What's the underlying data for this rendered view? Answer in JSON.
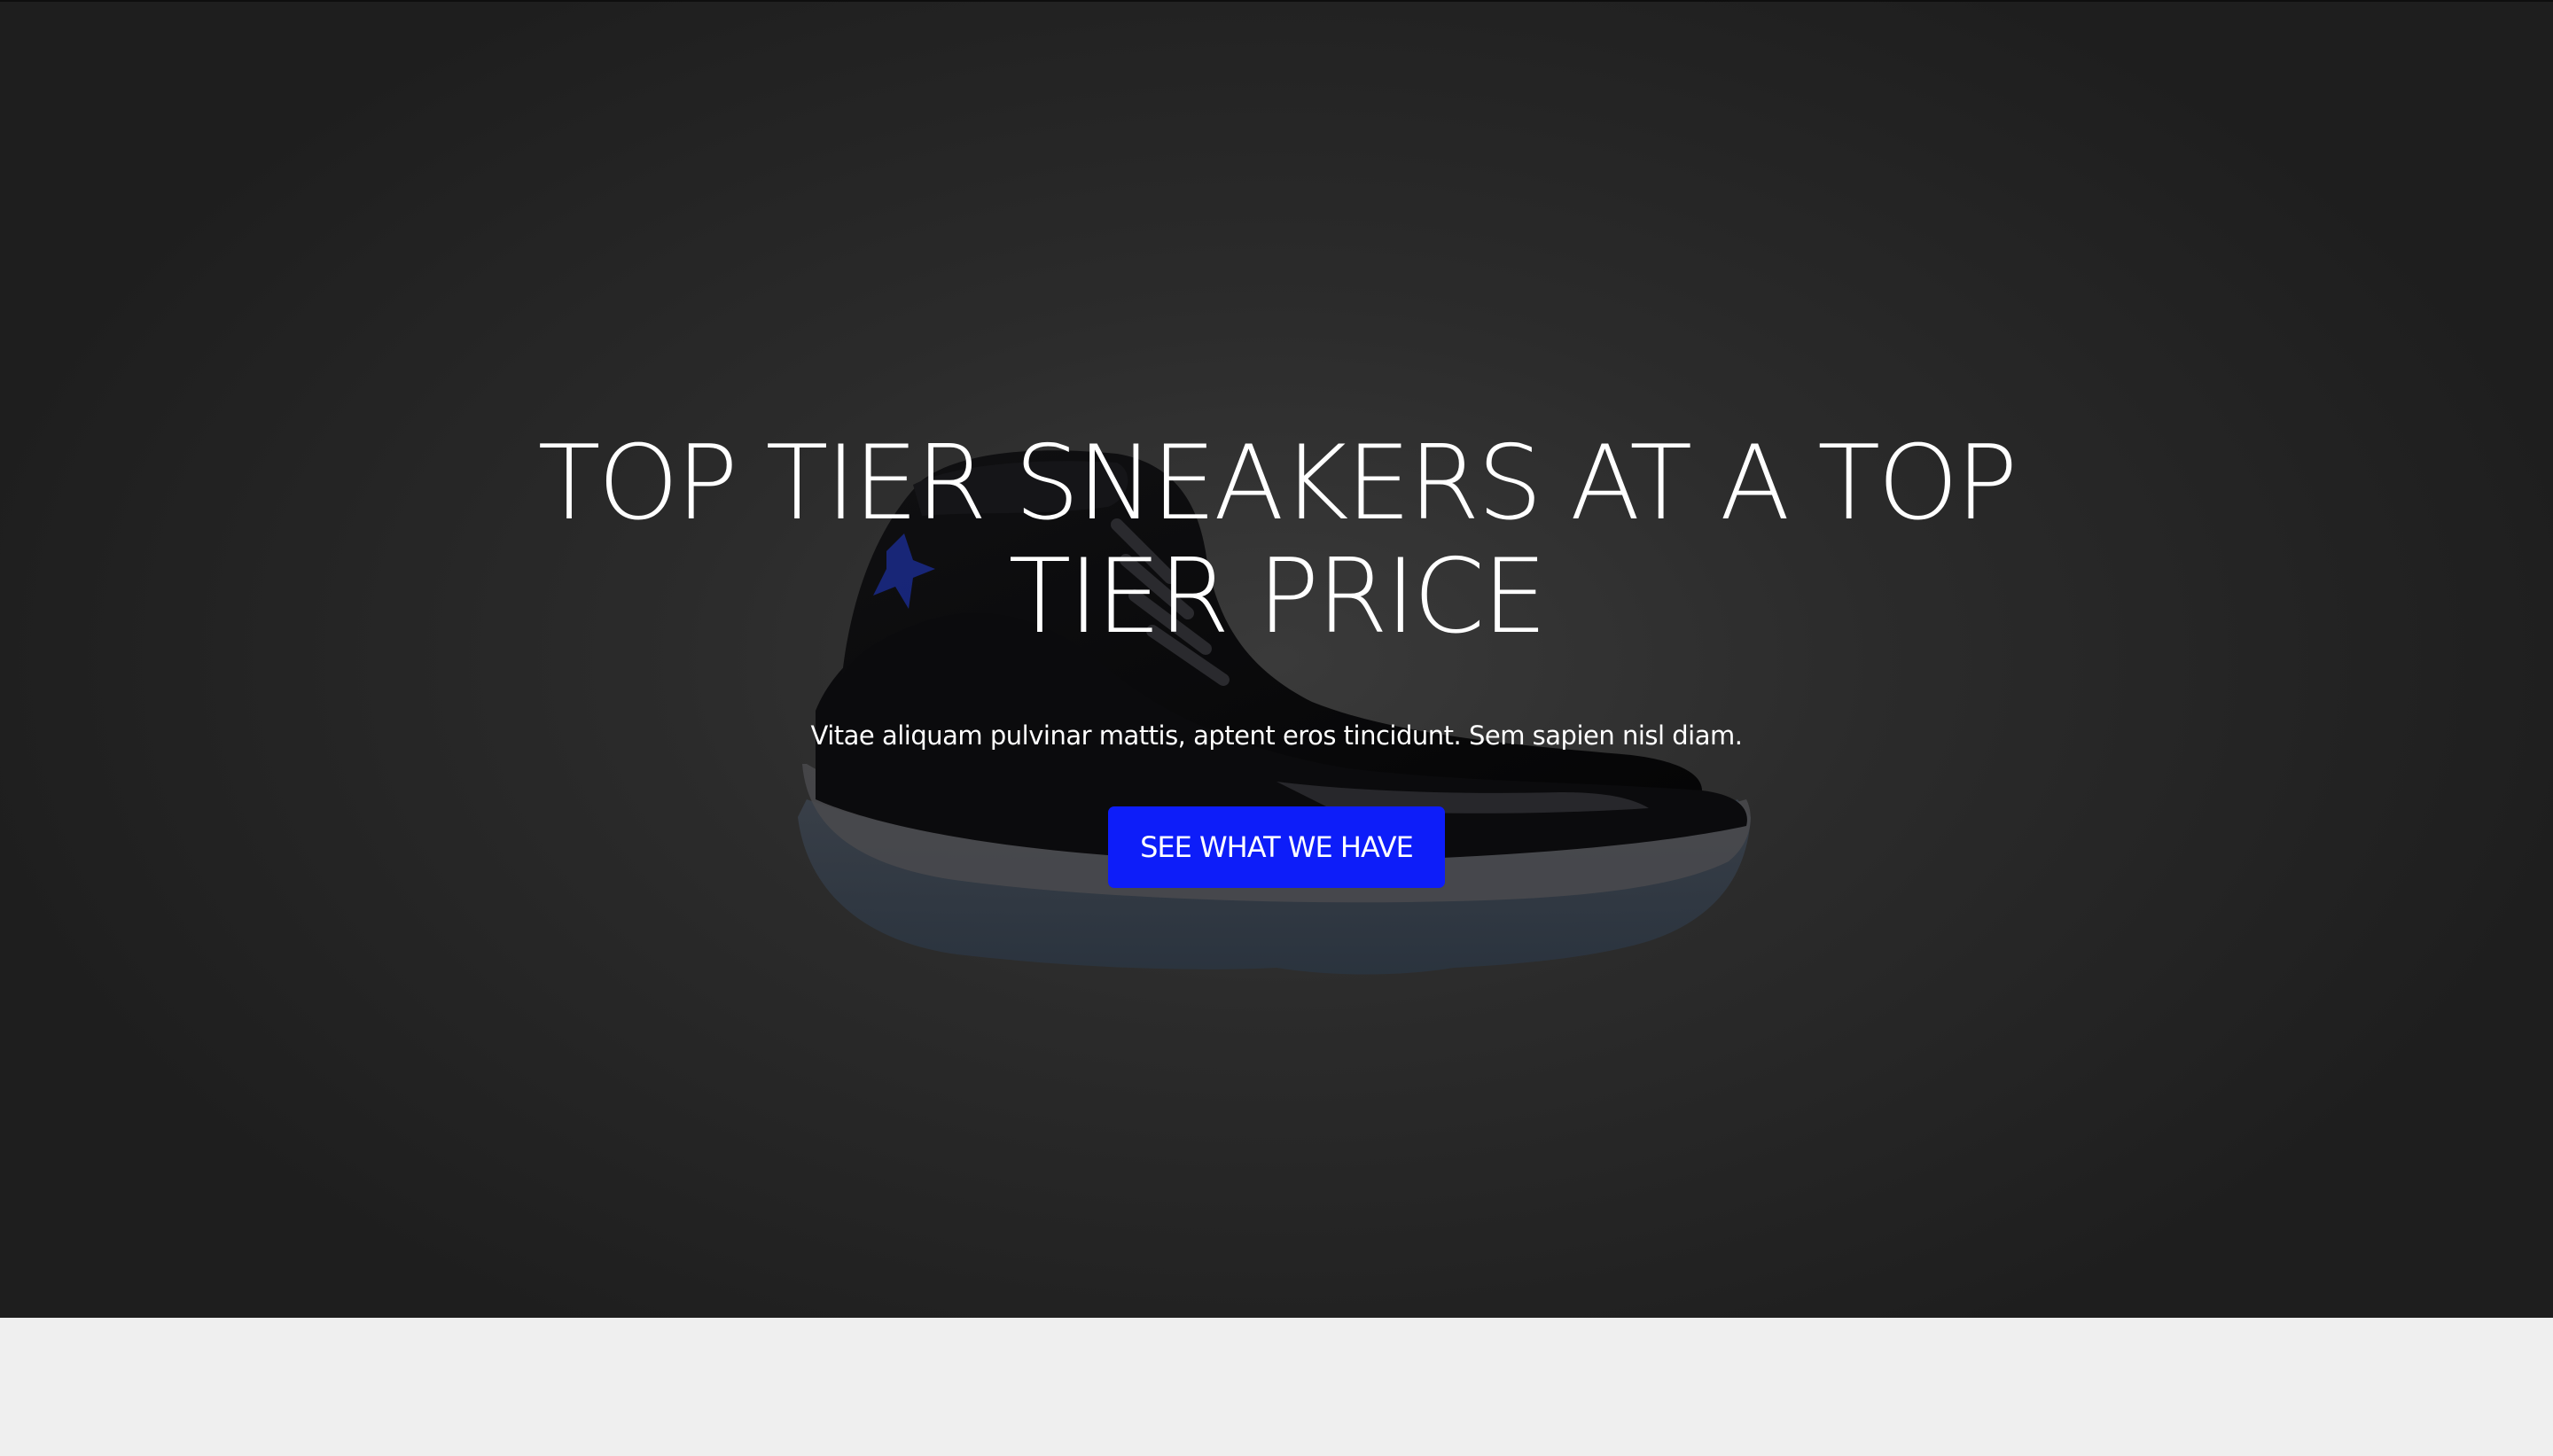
{
  "hero": {
    "title": "TOP TIER SNEAKERS AT A TOP TIER PRICE",
    "subtitle": "Vitae aliquam pulvinar mattis, aptent eros tincidunt. Sem sapien nisl diam.",
    "cta_label": "SEE WHAT WE HAVE",
    "background_image": "sneaker-image",
    "colors": {
      "overlay": "#2b2b2b",
      "cta_background": "#0d1df9",
      "text": "#ffffff",
      "page_background": "#efefef"
    }
  }
}
